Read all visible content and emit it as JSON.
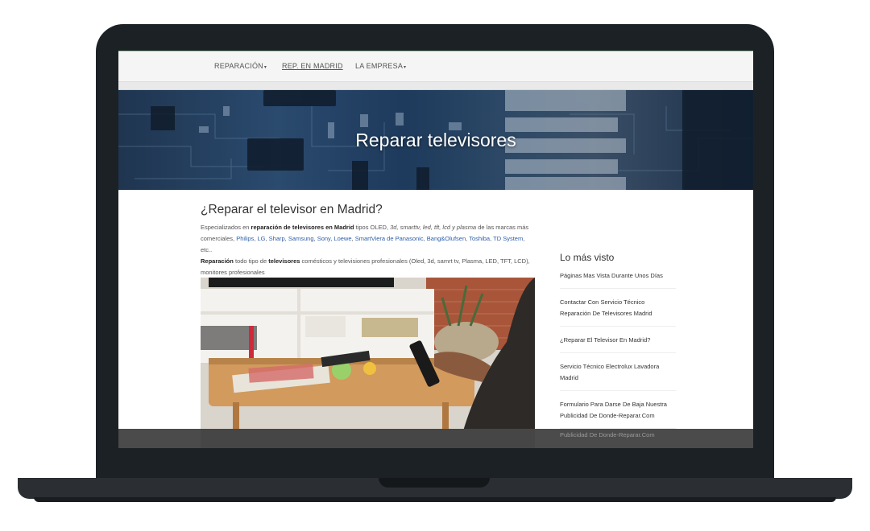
{
  "nav": {
    "reparacion": "REPARACIÓN",
    "madrid": "REP. EN MADRID",
    "empresa": "LA EMPRESA",
    "caret": "▾"
  },
  "hero": {
    "title": "Reparar televisores"
  },
  "main": {
    "heading": "¿Reparar el televisor en Madrid?",
    "p1": {
      "t1": "Especializados en ",
      "b1": "reparación de televisores en Madrid",
      "t2": " tipos OLED, ",
      "i1": "3d, smarttv, led, tft, lcd y plasma",
      "t3": " de las marcas más comerciales, ",
      "l_philips": "Philips",
      "l_lg": "LG",
      "l_sharp": "Sharp",
      "l_samsung": "Samsung",
      "l_sony": "Sony",
      "l_loewe": "Loewe",
      "l_smartviera": "SmartViera de Panasonic",
      "l_bang": "Bang&Olufsen",
      "l_toshiba": "Toshiba",
      "l_td": "TD System",
      "sep": ", ",
      "t4": ", etc.."
    },
    "p2": {
      "b1": "Reparación",
      "t1": " todo tipo de ",
      "b2": "televisores",
      "t2": " comésticos y televisiones profesionales (Oled, 3d, samrt tv, Plasma, LED, TFT, LCD), monitores profesionales"
    }
  },
  "sidebar": {
    "title": "Lo más visto",
    "items": [
      "Páginas Mas Vista Durante Unos Días",
      "Contactar Con Servicio Técnico Reparación De Televisores Madrid",
      "¿Reparar El Televisor En Madrid?",
      "Servicio Técnico Electrolux Lavadora Madrid",
      "Formulario Para Darse De Baja Nuestra Publicidad De Donde-Reparar.Com"
    ],
    "footer_item": "Publicidad De Donde-Reparar.Com"
  },
  "colors": {
    "link": "#2b5ea8",
    "navbar_bg": "#f5f5f5",
    "laptop_frame": "#1c2126"
  }
}
